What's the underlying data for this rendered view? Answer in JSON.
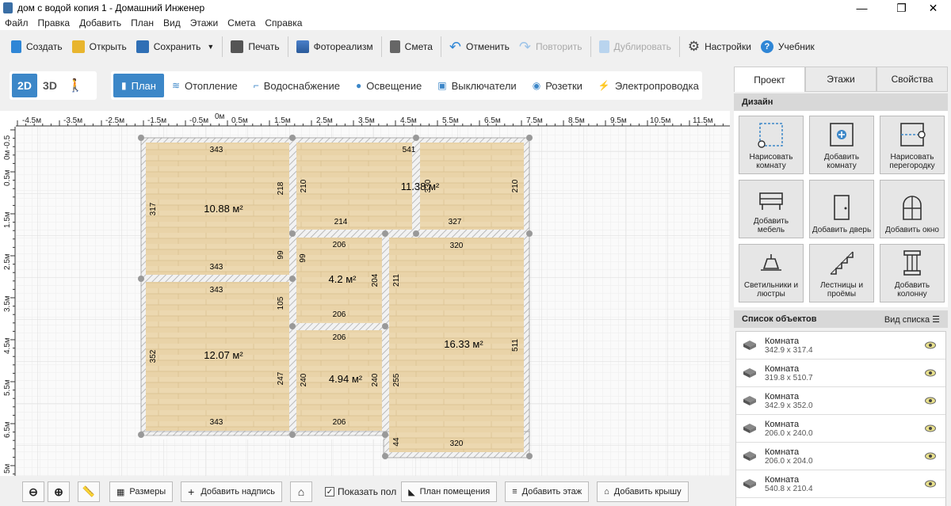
{
  "window": {
    "title": "дом с водой копия 1 - Домашний Инженер",
    "controls": [
      "—",
      "❐",
      "✕"
    ]
  },
  "menu": [
    "Файл",
    "Правка",
    "Добавить",
    "План",
    "Вид",
    "Этажи",
    "Смета",
    "Справка"
  ],
  "toolbar": {
    "create": "Создать",
    "open": "Открыть",
    "save": "Сохранить",
    "print": "Печать",
    "photo": "Фотореализм",
    "estimate": "Смета",
    "undo": "Отменить",
    "redo": "Повторить",
    "duplicate": "Дублировать",
    "settings": "Настройки",
    "tutorial": "Учебник"
  },
  "modes": {
    "m2d": "2D",
    "m3d": "3D"
  },
  "layers": [
    "План",
    "Отопление",
    "Водоснабжение",
    "Освещение",
    "Выключатели",
    "Розетки",
    "Электропроводка"
  ],
  "ruler": {
    "h": [
      "-4.5м",
      "-3.5м",
      "-2.5м",
      "-1.5м",
      "-0.5м",
      "0м",
      "0.5м",
      "1.5м",
      "2.5м",
      "3.5м",
      "4.5м",
      "5.5м",
      "6.5м",
      "7.5м",
      "8.5м",
      "9.5м",
      "10.5м",
      "11.5м"
    ],
    "v": [
      "-0.5",
      "0м",
      "0.5м",
      "1.5м",
      "2.5м",
      "3.5м",
      "4.5м",
      "5.5м",
      "6.5м",
      "5м"
    ]
  },
  "rooms": [
    {
      "area": "10.88 м²",
      "dims": [
        "343",
        "317",
        "218",
        "99",
        "343"
      ]
    },
    {
      "area": "12.07 м²",
      "dims": [
        "343",
        "352",
        "105",
        "247",
        "343"
      ]
    },
    {
      "area": "11.38 м²",
      "dims": [
        "541",
        "210",
        "214",
        "327",
        "210",
        "330"
      ]
    },
    {
      "area": "4.2 м²",
      "dims": [
        "206",
        "99",
        "204",
        "206"
      ]
    },
    {
      "area": "4.94 м²",
      "dims": [
        "206",
        "240",
        "240",
        "206"
      ]
    },
    {
      "area": "16.33 м²",
      "dims": [
        "320",
        "211",
        "511",
        "255",
        "44",
        "320"
      ]
    }
  ],
  "bottom": {
    "sizes": "Размеры",
    "addlabel": "Добавить надпись",
    "showfloor": "Показать пол",
    "roomplan": "План помещения",
    "addfloor": "Добавить этаж",
    "addroof": "Добавить крышу"
  },
  "panel": {
    "tabs": [
      "Проект",
      "Этажи",
      "Свойства"
    ],
    "design": "Дизайн",
    "tools": [
      "Нарисовать комнату",
      "Добавить комнату",
      "Нарисовать перегородку",
      "Добавить мебель",
      "Добавить дверь",
      "Добавить окно",
      "Светильники и люстры",
      "Лестницы и проёмы",
      "Добавить колонну"
    ],
    "objlist": "Список объектов",
    "listview": "Вид списка",
    "objects": [
      {
        "name": "Комната",
        "size": "342.9 x 317.4"
      },
      {
        "name": "Комната",
        "size": "319.8 x 510.7"
      },
      {
        "name": "Комната",
        "size": "342.9 x 352.0"
      },
      {
        "name": "Комната",
        "size": "206.0 x 240.0"
      },
      {
        "name": "Комната",
        "size": "206.0 x 204.0"
      },
      {
        "name": "Комната",
        "size": "540.8 x 210.4"
      }
    ]
  }
}
